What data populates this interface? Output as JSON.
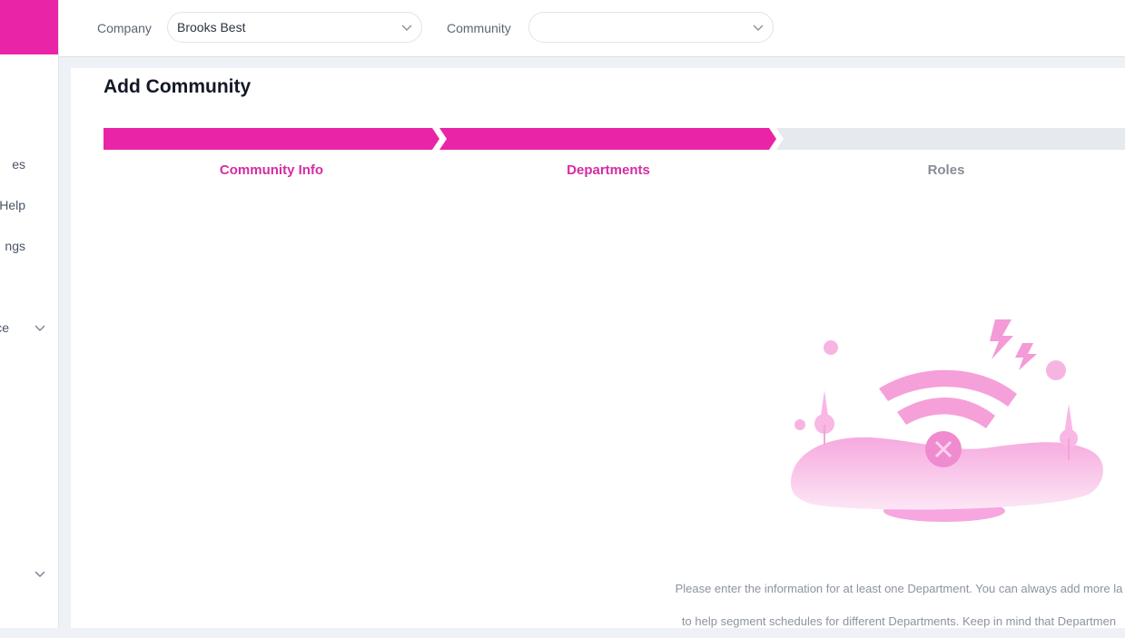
{
  "sidebar": {
    "items": [
      {
        "label": "es"
      },
      {
        "label": "Help"
      },
      {
        "label": "ngs"
      },
      {
        "label": "ce"
      }
    ]
  },
  "topbar": {
    "company_label": "Company",
    "company_value": "Brooks Best",
    "community_label": "Community",
    "community_value": ""
  },
  "page": {
    "title": "Add Community"
  },
  "stepper": {
    "steps": [
      {
        "label": "Community Info",
        "state": "complete"
      },
      {
        "label": "Departments",
        "state": "active"
      },
      {
        "label": "Roles",
        "state": "pending"
      }
    ]
  },
  "empty_state": {
    "line1": "Please enter the information for at least one Department. You can always add more la",
    "line2": "to help segment schedules for different Departments. Keep in mind that Departmen"
  },
  "colors": {
    "accent": "#ea24a6",
    "pending": "#e6e9ee"
  }
}
